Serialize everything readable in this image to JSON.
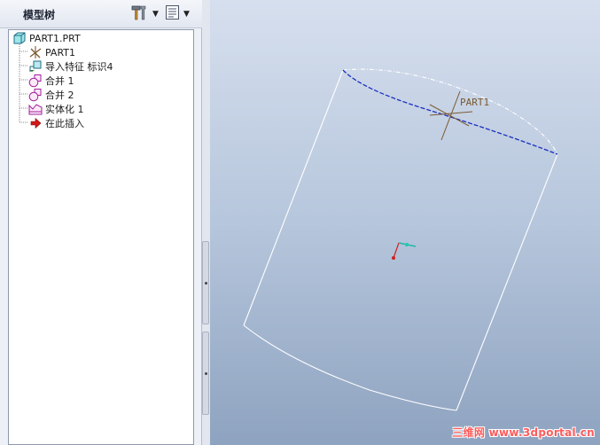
{
  "navigator": {
    "title": "模型树",
    "settings_icon": "hammer-settings-icon",
    "show_icon": "list-view-icon"
  },
  "tree": {
    "root": "PART1.PRT",
    "items": [
      {
        "label": "PART1",
        "icon": "coordinate-system-icon"
      },
      {
        "label": "导入特征 标识4",
        "icon": "import-feature-icon"
      },
      {
        "label": "合并 1",
        "icon": "merge-icon"
      },
      {
        "label": "合并 2",
        "icon": "merge-icon"
      },
      {
        "label": "实体化 1",
        "icon": "solidify-icon"
      },
      {
        "label": "在此插入",
        "icon": "insert-here-arrow-icon"
      }
    ]
  },
  "viewport": {
    "csys_label": "PART1",
    "watermark": "三维网 www.3dportal.cn",
    "colors": {
      "background_top": "#d6dfee",
      "background_bottom": "#8ea3c0",
      "edge": "#ffffff",
      "highlight_edge": "#1a2fc0",
      "csys": "#7a5a30"
    }
  }
}
